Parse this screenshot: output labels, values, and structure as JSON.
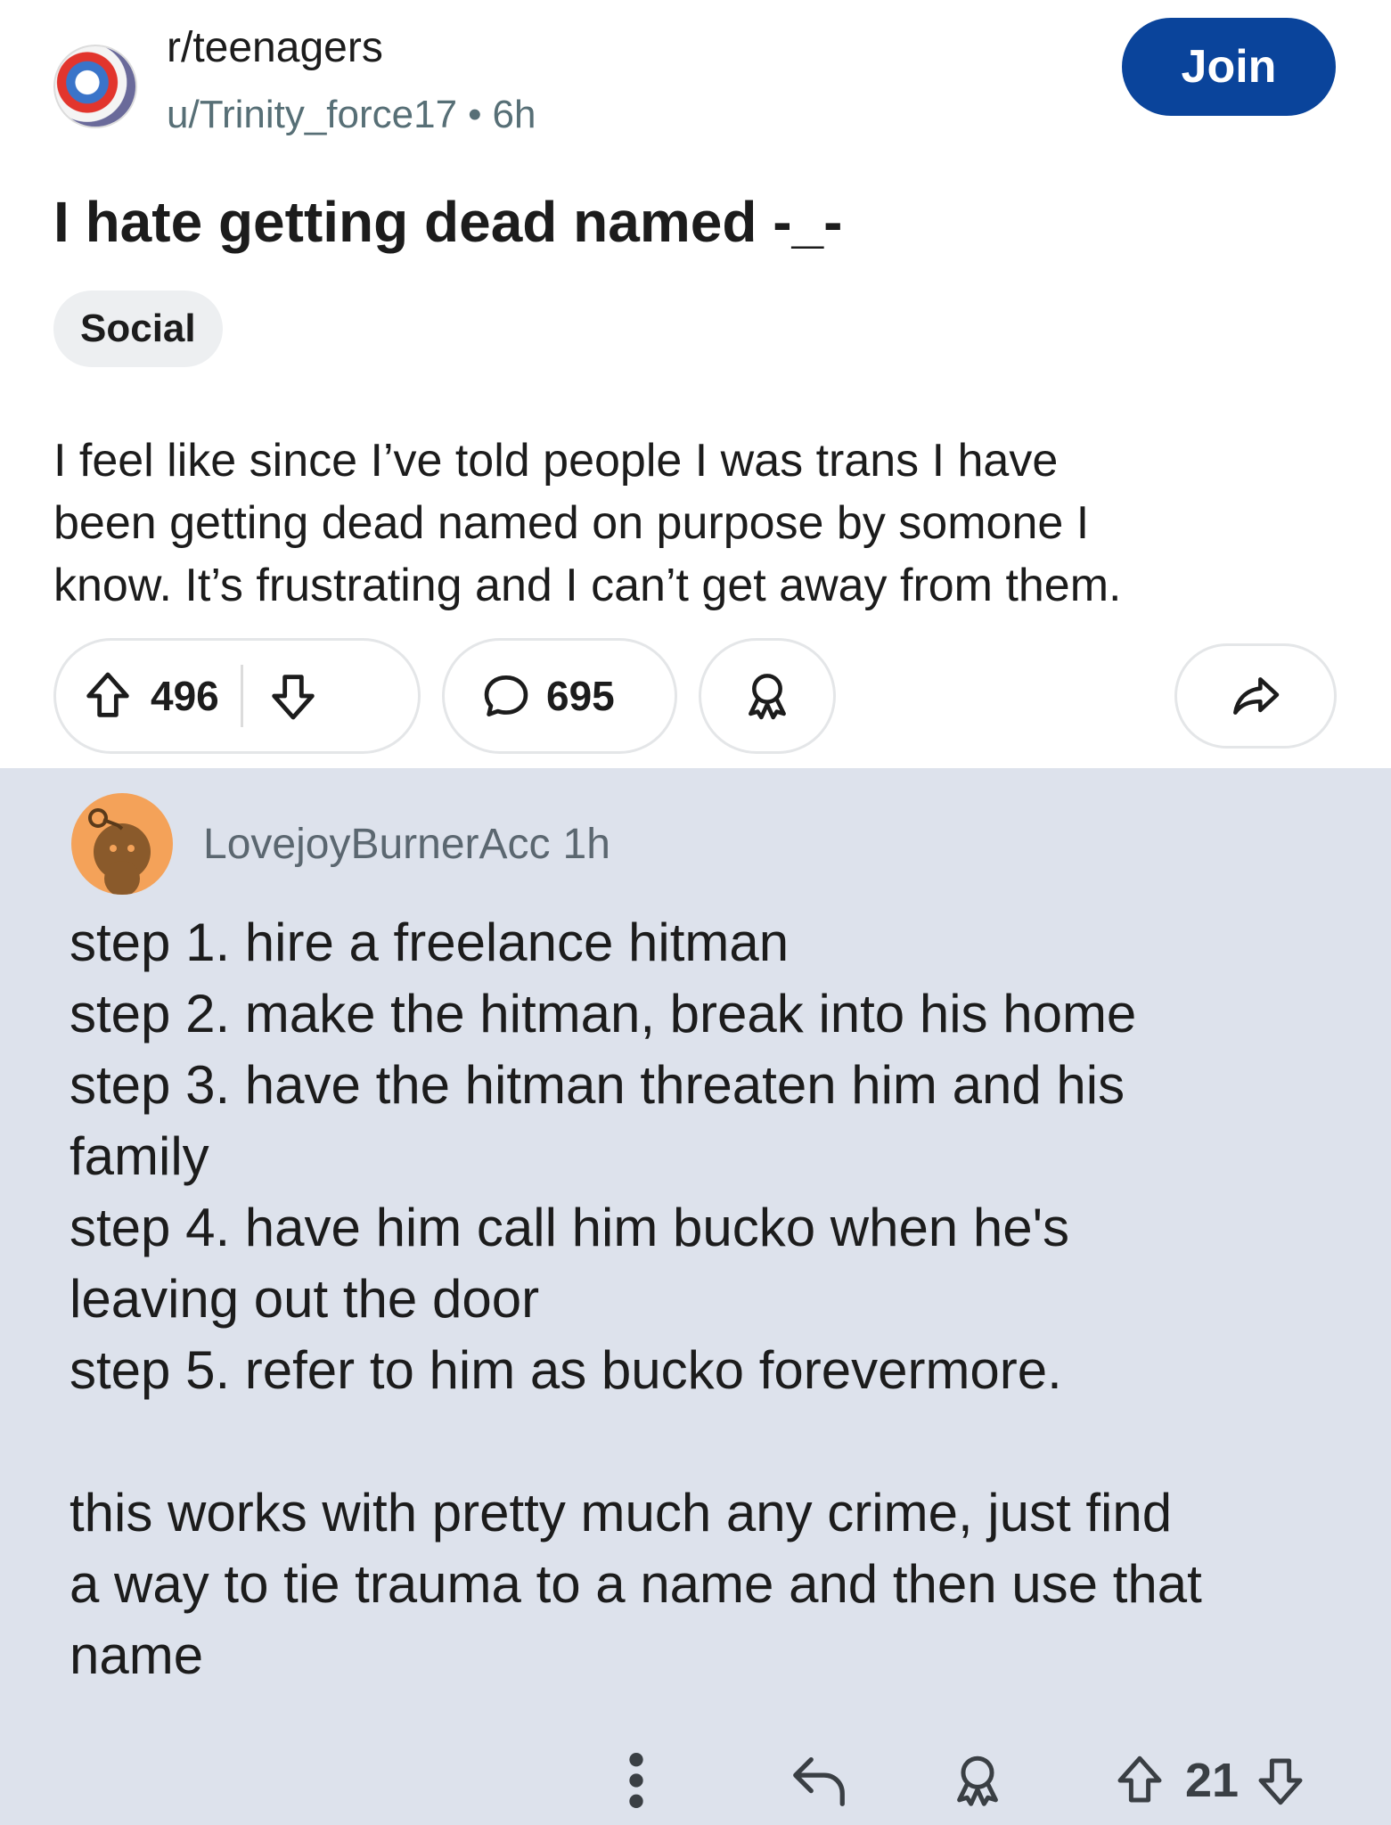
{
  "post": {
    "subreddit": "r/teenagers",
    "author": "u/Trinity_force17",
    "age": "6h",
    "dot": "•",
    "join_label": "Join",
    "title": "I hate getting dead named -_-",
    "flair": "Social",
    "body": "I feel like since I’ve told people I was trans I have\nbeen getting dead named on purpose by somone I\nknow. It’s frustrating and I can’t get away from them.",
    "upvotes": "496",
    "comments": "695"
  },
  "comment": {
    "username": "LovejoyBurnerAcc",
    "age": "1h",
    "text": "step 1. hire a freelance hitman\nstep 2. make the hitman, break into his home\nstep 3. have the hitman threaten him and his\nfamily\nstep 4. have him call him bucko when he's\nleaving out the door\nstep 5. refer to him as bucko forevermore.\n\nthis works with pretty much any crime, just find\na way to tie trauma to a name and then use that\nname",
    "votes": "21"
  },
  "icons": [
    "upvote-icon",
    "downvote-icon",
    "comment-icon",
    "award-icon",
    "share-icon",
    "more-icon",
    "reply-icon"
  ],
  "colors": {
    "join": "#0a449b",
    "comment_bg": "#dde2ec",
    "flair_bg": "#edeff1",
    "avatar": "#f4a259"
  }
}
